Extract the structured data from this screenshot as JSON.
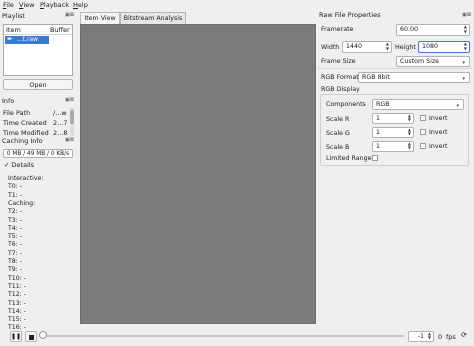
{
  "menu": [
    "File",
    "View",
    "Playback",
    "Help"
  ],
  "playlist": {
    "title": "Playlist",
    "col_item": "Item",
    "col_buffer": "Buffer",
    "row_name": "...t.raw",
    "open_label": "Open"
  },
  "info": {
    "title": "Info",
    "rows": [
      {
        "k": "File Path",
        "v": "/...w"
      },
      {
        "k": "Time Created",
        "v": "2...7"
      },
      {
        "k": "Time Modified",
        "v": "2...8"
      }
    ]
  },
  "caching": {
    "title": "Caching Info",
    "progress_text": "0 MB / 49 MB / 0 KB/s",
    "progress": 0,
    "details_label": "Details",
    "lines": [
      "Interactive:",
      "T0: -",
      "T1: -",
      "Caching:",
      "T2: -",
      "T3: -",
      "T4: -",
      "T5: -",
      "T6: -",
      "T7: -",
      "T8: -",
      "T9: -",
      "T10: -",
      "T11: -",
      "T12: -",
      "T13: -",
      "T14: -",
      "T15: -",
      "T16: -"
    ]
  },
  "tabs": [
    "Item View",
    "Bitstream Analysis"
  ],
  "raw": {
    "title": "Raw File Properties",
    "framerate_label": "Framerate",
    "framerate": "60.00",
    "width_label": "Width",
    "width": "1440",
    "height_label": "Height",
    "height": "1080",
    "frame_size_label": "Frame Size",
    "frame_size": "Custom Size",
    "rgb_format_label": "RGB Format",
    "rgb_format": "RGB 8bit",
    "rgb_display_label": "RGB Display",
    "components_label": "Components",
    "components": "RGB",
    "scales": [
      {
        "label": "Scale R",
        "value": "1"
      },
      {
        "label": "Scale G",
        "value": "1"
      },
      {
        "label": "Scale B",
        "value": "1"
      }
    ],
    "invert_label": "Invert",
    "limited_range_label": "Limited Range"
  },
  "playback": {
    "frame": "-1",
    "fps": "0",
    "fps_label": "fps"
  },
  "colors": {
    "viewer": "#7b7b7b",
    "selection": "#3a7ad0"
  }
}
